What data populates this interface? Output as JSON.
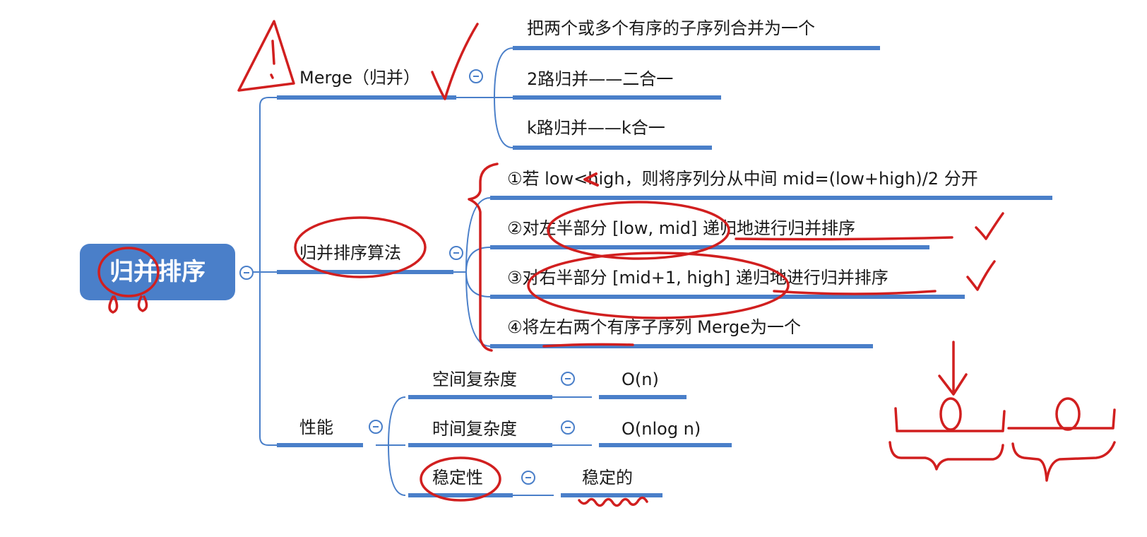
{
  "root": {
    "label": "归并排序",
    "color": "#4a7fc9"
  },
  "branches": {
    "merge": {
      "label": "Merge（归并）",
      "children": [
        "把两个或多个有序的子序列合并为一个",
        "2路归并——二合一",
        "k路归并——k合一"
      ]
    },
    "algorithm": {
      "label": "归并排序算法",
      "steps": [
        "①若 low<high，则将序列分从中间 mid=(low+high)/2 分开",
        "②对左半部分 [low, mid] 递归地进行归并排序",
        "③对右半部分 [mid+1, high] 递归地进行归并排序",
        "④将左右两个有序子序列 Merge为一个"
      ]
    },
    "performance": {
      "label": "性能",
      "items": [
        {
          "name": "空间复杂度",
          "value": "O(n)"
        },
        {
          "name": "时间复杂度",
          "value": "O(nlog n)"
        },
        {
          "name": "稳定性",
          "value": "稳定的"
        }
      ]
    }
  },
  "colors": {
    "line": "#4a7fc9",
    "annotation": "#d11f1f",
    "text": "#1a1a1a"
  }
}
